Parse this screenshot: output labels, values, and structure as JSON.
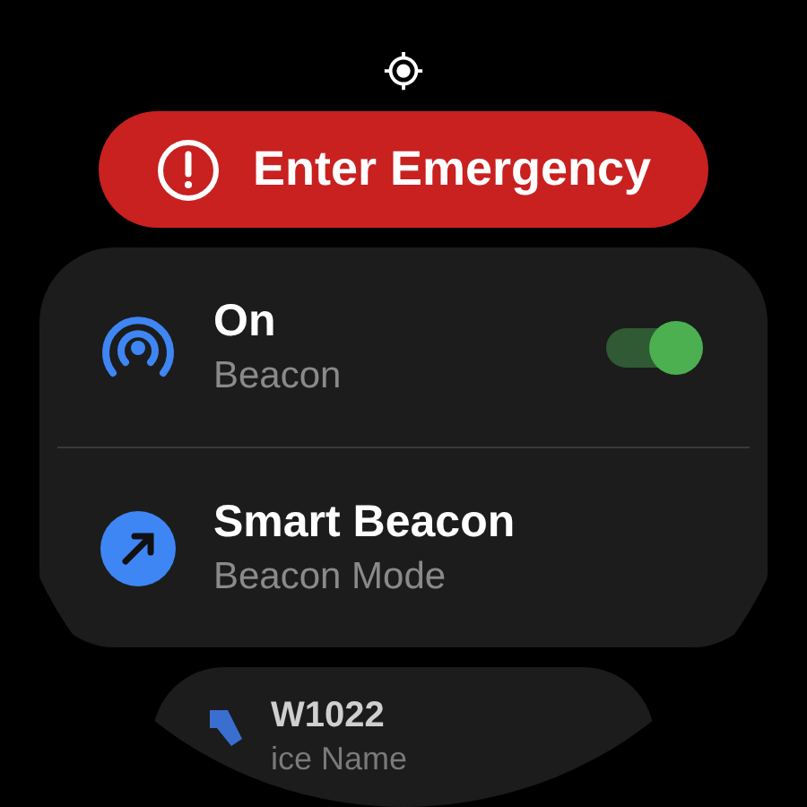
{
  "emergency_button": {
    "label": "Enter Emergency"
  },
  "settings": [
    {
      "kind": "toggle",
      "title": "On",
      "subtitle": "Beacon",
      "on": true
    },
    {
      "kind": "link",
      "title": "Smart Beacon",
      "subtitle": "Beacon Mode"
    }
  ],
  "device": {
    "title": "W1022",
    "subtitle": "ice Name"
  }
}
